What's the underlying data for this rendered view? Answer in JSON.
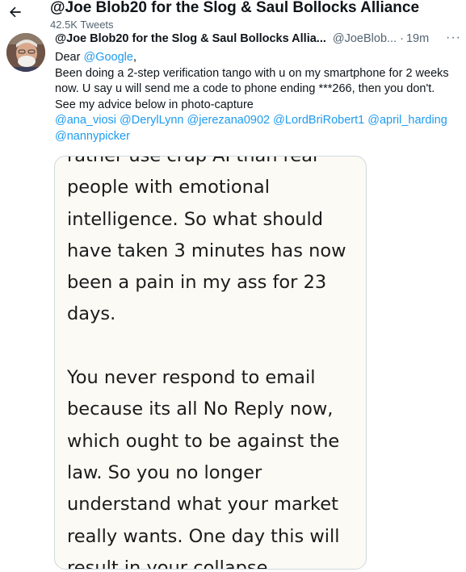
{
  "header": {
    "title": "@Joe Blob20 for the Slog & Saul Bollocks Alliance",
    "tweet_count": "42.5K Tweets"
  },
  "tweet": {
    "display_name": "@Joe Blob20 for the Slog & Saul Bollocks Allia...",
    "handle": "@JoeBlob...",
    "separator": "·",
    "time": "19m",
    "more_icon": "···",
    "greeting_prefix": "Dear ",
    "greeting_mention": "@Google",
    "greeting_suffix": ",",
    "body": "Been doing a 2-step verification tango with u on my smartphone for 2 weeks now. U say u will send me a code to phone ending ***266, then you don't. See my advice below in photo-capture",
    "mentions": [
      "@ana_viosi",
      "@DerylLynn",
      "@jerezana0902",
      "@LordBriRobert1",
      "@april_harding",
      "@nannypicker"
    ]
  },
  "photo": {
    "cut_top_line": "rather use crap AI than real",
    "lines_1": [
      "people with emotional",
      "intelligence. So what should",
      "have taken 3 minutes has now",
      "been a pain in my ass for 23",
      "days."
    ],
    "lines_2": [
      "You never respond to email",
      "because its all No Reply now,",
      "which ought to be against the",
      "law. So you no longer",
      "understand what your market",
      "really wants. One day this will",
      "result in your collapse."
    ]
  },
  "colors": {
    "link": "#1d9bf0",
    "muted": "#536471",
    "text": "#0f1419",
    "photo_bg": "#fbfaf4"
  },
  "icons": {
    "back": "arrow-left-icon",
    "more": "more-horizontal-icon"
  }
}
